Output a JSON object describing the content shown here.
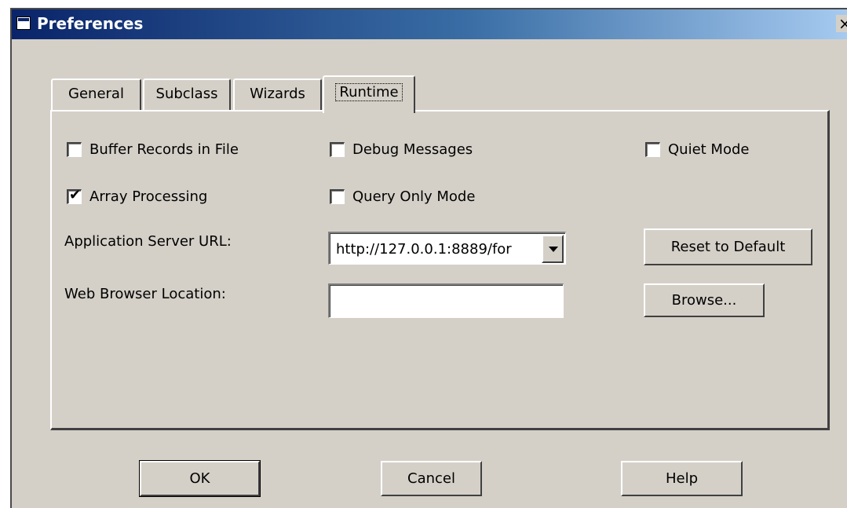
{
  "window": {
    "title": "Preferences",
    "close_glyph": "×",
    "icon": "window-icon"
  },
  "tabs": [
    {
      "label": "General",
      "active": false
    },
    {
      "label": "Subclass",
      "active": false
    },
    {
      "label": "Wizards",
      "active": false
    },
    {
      "label": "Runtime",
      "active": true
    }
  ],
  "options": {
    "buffer_records": {
      "label": "Buffer Records in File",
      "checked": false
    },
    "debug_messages": {
      "label": "Debug Messages",
      "checked": false
    },
    "quiet_mode": {
      "label": "Quiet Mode",
      "checked": false
    },
    "array_processing": {
      "label": "Array Processing",
      "checked": true
    },
    "query_only": {
      "label": "Query Only Mode",
      "checked": false
    }
  },
  "app_server": {
    "label": "Application Server URL:",
    "value": "http://127.0.0.1:8889/for"
  },
  "web_browser": {
    "label": "Web Browser Location:",
    "value": ""
  },
  "buttons": {
    "reset": "Reset to Default",
    "browse": "Browse...",
    "ok": "OK",
    "cancel": "Cancel",
    "help": "Help"
  },
  "colors": {
    "dialog_bg": "#d4d0c8",
    "title_start": "#0a246a",
    "title_end": "#a6caf0"
  }
}
